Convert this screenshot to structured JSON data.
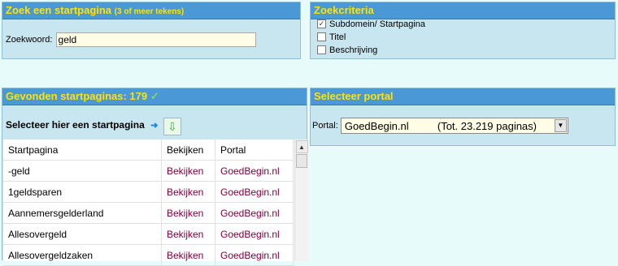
{
  "search": {
    "title": "Zoek een startpagina",
    "subtitle": "(3 of meer tekens)",
    "label": "Zoekwoord:",
    "value": "geld"
  },
  "criteria": {
    "title": "Zoekcriteria",
    "items": [
      {
        "label": "Subdomein/ Startpagina",
        "checked": true,
        "mark": "✓"
      },
      {
        "label": "Titel",
        "checked": false,
        "mark": ""
      },
      {
        "label": "Beschrijving",
        "checked": false,
        "mark": ""
      }
    ]
  },
  "results": {
    "title": "Gevonden startpaginas: 179",
    "check": "✓",
    "select_label": "Selecteer hier een startpagina",
    "arrow": "➜",
    "download_icon": "⇩",
    "columns": [
      "Startpagina",
      "Bekijken",
      "Portal"
    ],
    "rows": [
      {
        "name": "-geld",
        "view": "Bekijken",
        "portal": "GoedBegin.nl"
      },
      {
        "name": "1geldsparen",
        "view": "Bekijken",
        "portal": "GoedBegin.nl"
      },
      {
        "name": "Aannemersgelderland",
        "view": "Bekijken",
        "portal": "GoedBegin.nl"
      },
      {
        "name": "Allesovergeld",
        "view": "Bekijken",
        "portal": "GoedBegin.nl"
      },
      {
        "name": "Allesovergeldzaken",
        "view": "Bekijken",
        "portal": "GoedBegin.nl"
      }
    ]
  },
  "portal": {
    "title": "Selecteer portal",
    "label": "Portal:",
    "selected": "GoedBegin.nl",
    "count": "(Tot. 23.219 paginas)",
    "dropdown_icon": "▼"
  },
  "colors": {
    "header_bg": "#4a98d6",
    "header_text": "#ffe400",
    "panel_bg": "#c7e6ef",
    "link": "#800040"
  }
}
